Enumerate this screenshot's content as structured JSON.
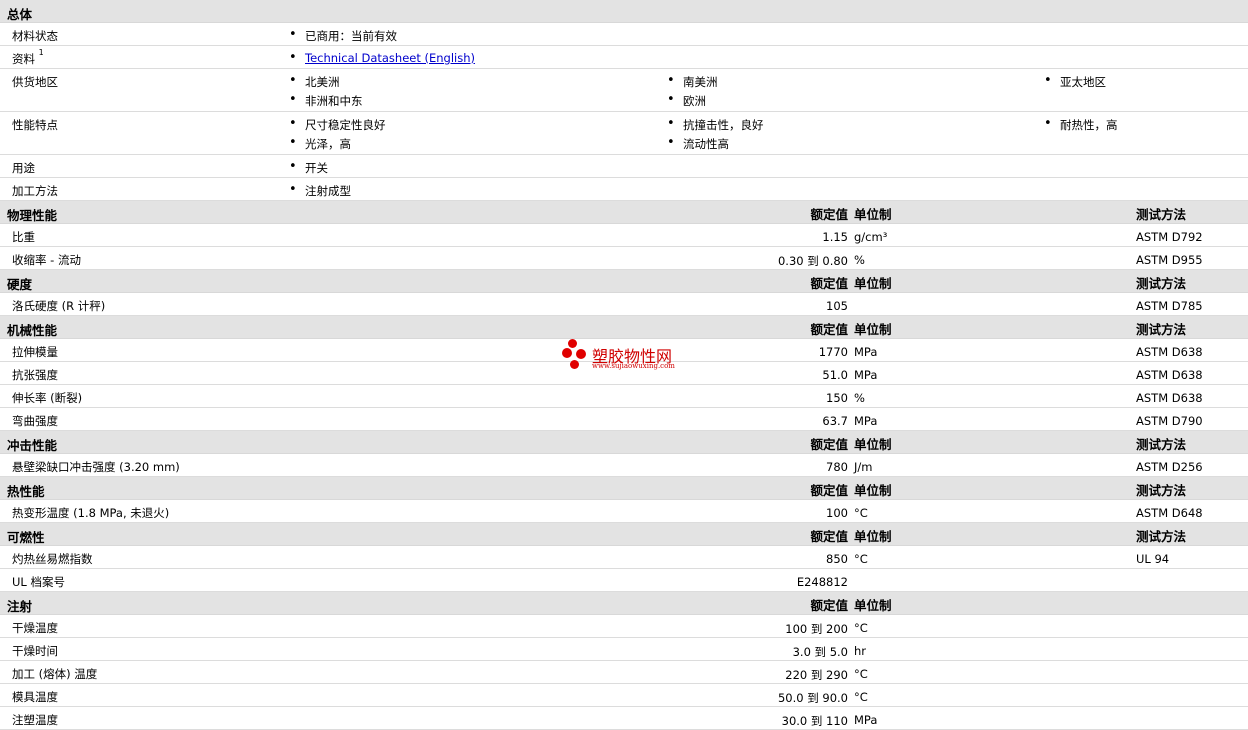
{
  "general": {
    "title": "总体",
    "status_label": "材料状态",
    "status_value": "已商用：当前有效",
    "literature_label": "资料",
    "literature_sup": "1",
    "literature_link": "Technical Datasheet (English)",
    "availability_label": "供货地区",
    "availability": [
      "北美洲",
      "南美洲",
      "亚太地区",
      "非洲和中东",
      "欧洲"
    ],
    "features_label": "性能特点",
    "features": [
      "尺寸稳定性良好",
      "抗撞击性，良好",
      "耐热性，高",
      "光泽，高",
      "流动性高"
    ],
    "uses_label": "用途",
    "uses_value": "开关",
    "processing_label": "加工方法",
    "processing_value": "注射成型"
  },
  "headers": {
    "nominal": "额定值",
    "unit": "单位制",
    "method": "测试方法"
  },
  "physical": {
    "title": "物理性能",
    "rows": [
      {
        "name": "比重",
        "value": "1.15",
        "unit": "g/cm³",
        "method": "ASTM D792"
      },
      {
        "name": "收缩率 - 流动",
        "value": "0.30 到  0.80",
        "unit": "%",
        "method": "ASTM D955"
      }
    ]
  },
  "hardness": {
    "title": "硬度",
    "rows": [
      {
        "name": "洛氏硬度 (R 计秤)",
        "value": "105",
        "unit": "",
        "method": "ASTM D785"
      }
    ]
  },
  "mechanical": {
    "title": "机械性能",
    "rows": [
      {
        "name": "拉伸模量",
        "value": "1770",
        "unit": "MPa",
        "method": "ASTM D638"
      },
      {
        "name": "抗张强度",
        "value": "51.0",
        "unit": "MPa",
        "method": "ASTM D638"
      },
      {
        "name": "伸长率 (断裂)",
        "value": "150",
        "unit": "%",
        "method": "ASTM D638"
      },
      {
        "name": "弯曲强度",
        "value": "63.7",
        "unit": "MPa",
        "method": "ASTM D790"
      }
    ]
  },
  "impact": {
    "title": "冲击性能",
    "rows": [
      {
        "name": "悬壁梁缺口冲击强度 (3.20 mm)",
        "value": "780",
        "unit": "J/m",
        "method": "ASTM D256"
      }
    ]
  },
  "thermal": {
    "title": "热性能",
    "rows": [
      {
        "name": "热变形温度 (1.8 MPa, 未退火)",
        "value": "100",
        "unit": "°C",
        "method": "ASTM D648"
      }
    ]
  },
  "flammability": {
    "title": "可燃性",
    "rows": [
      {
        "name": "灼热丝易燃指数",
        "value": "850",
        "unit": "°C",
        "method": "UL 94"
      },
      {
        "name": "UL 档案号",
        "value": "E248812",
        "unit": "",
        "method": ""
      }
    ]
  },
  "injection": {
    "title": "注射",
    "rows": [
      {
        "name": "干燥温度",
        "value": "100 到  200",
        "unit": "°C"
      },
      {
        "name": "干燥时间",
        "value": "3.0 到  5.0",
        "unit": "hr"
      },
      {
        "name": "加工 (熔体) 温度",
        "value": "220 到  290",
        "unit": "°C"
      },
      {
        "name": "模具温度",
        "value": "50.0 到  90.0",
        "unit": "°C"
      },
      {
        "name": "注塑温度",
        "value": "30.0 到  110",
        "unit": "MPa"
      }
    ]
  },
  "watermark": {
    "name": "塑胶物性网",
    "url": "www.sujiaowuxing.com"
  }
}
